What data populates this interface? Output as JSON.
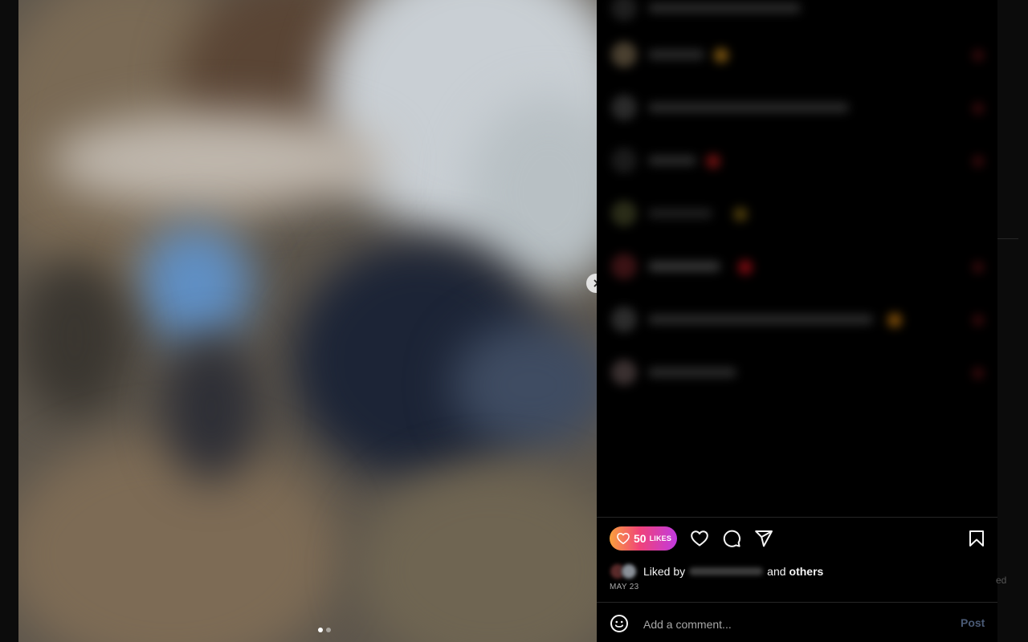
{
  "post": {
    "likes_count": "50",
    "likes_word": "LIKES",
    "liked_by_prefix": "Liked by",
    "liked_by_and": "and",
    "liked_by_others": "others",
    "date": "MAY 23",
    "media_dots": 2,
    "active_dot": 1
  },
  "comment_box": {
    "placeholder": "Add a comment...",
    "post_label": "Post"
  },
  "right_edge_text": "ed",
  "icons": {
    "next": "chevron-right-icon",
    "like": "heart-icon",
    "comment": "comment-bubble-icon",
    "share": "paper-plane-icon",
    "save": "bookmark-icon",
    "emoji": "smiley-icon"
  },
  "colors": {
    "background": "#000000",
    "likes_gradient": [
      "#f9a13c",
      "#f0427a",
      "#c13ae0"
    ],
    "post_button_disabled": "#4a5a75",
    "secondary_text": "#a8a8a8"
  }
}
